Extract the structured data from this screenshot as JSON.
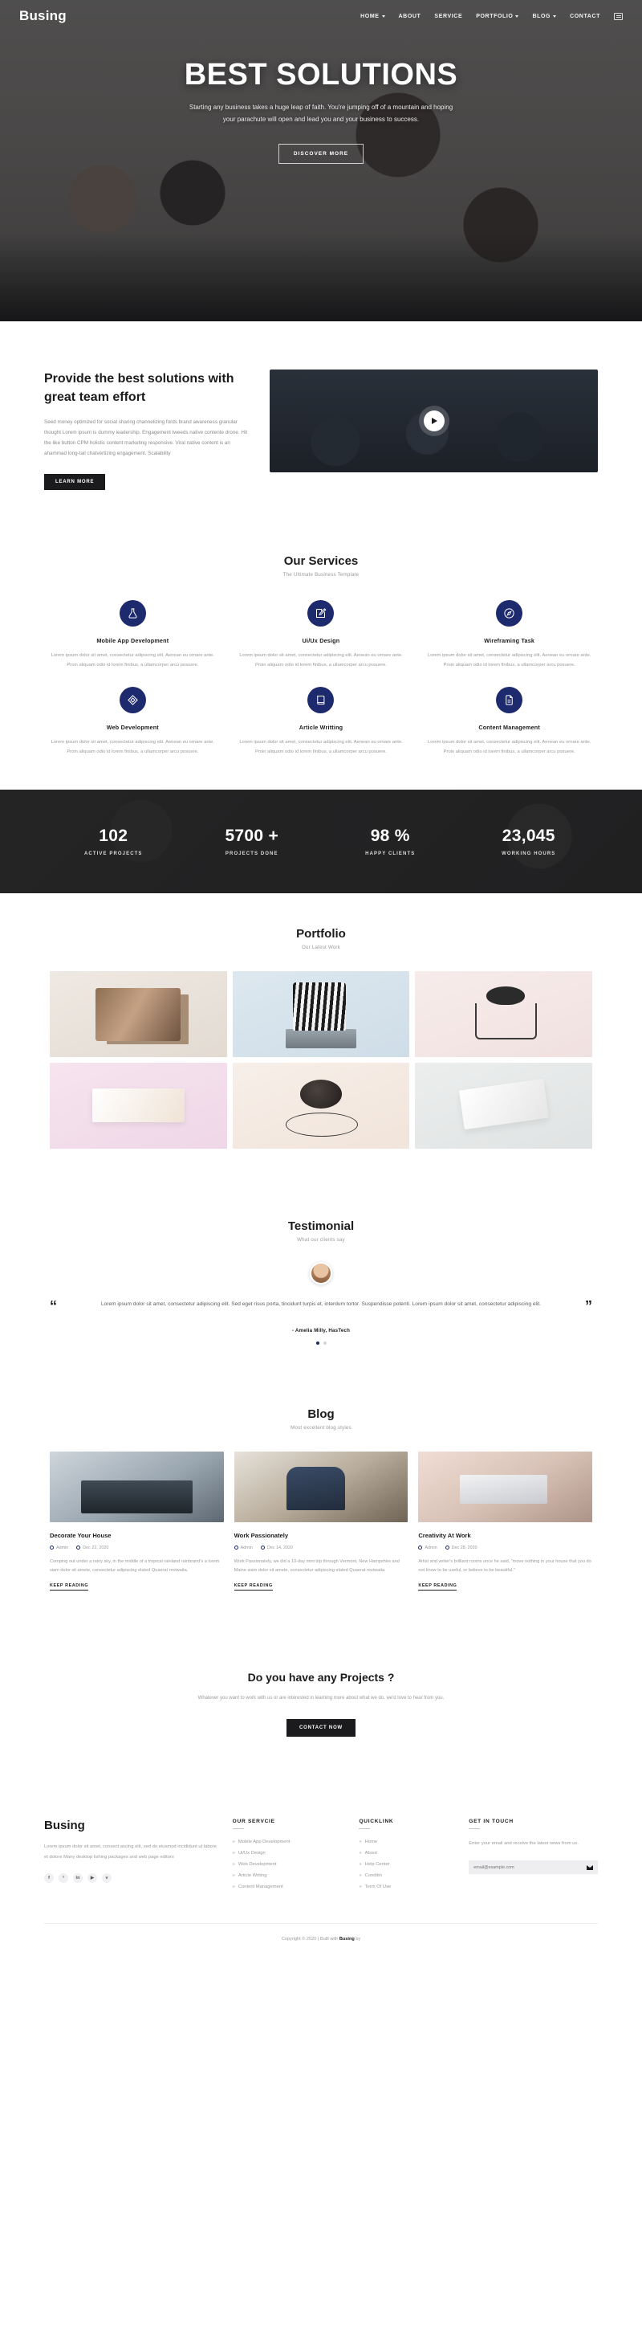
{
  "header": {
    "brand": "Busing",
    "nav": [
      {
        "label": "HOME",
        "dropdown": true
      },
      {
        "label": "ABOUT",
        "dropdown": false
      },
      {
        "label": "SERVICE",
        "dropdown": false
      },
      {
        "label": "PORTFOLIO",
        "dropdown": true
      },
      {
        "label": "BLOG",
        "dropdown": true
      },
      {
        "label": "CONTACT",
        "dropdown": false
      }
    ],
    "menu_icon": "hamburger-icon"
  },
  "hero": {
    "title": "BEST SOLUTIONS",
    "subtitle": "Starting any business takes a huge leap of faith. You're jumping off of a mountain and hoping your parachute will open and lead you and your business to success.",
    "cta": "DISCOVER MORE"
  },
  "about": {
    "title": "Provide the best solutions with great team effort",
    "body": "Seed money optimized for social sharing channelizing fords brand awareness granular thought Lorem ipsum is dummy leadership. Engagement tweeds native contente drone. Hit the like button CPM holistic content marketing responsive. Viral native content is an ahammad long-tail chatvertizing engagement. Scalability",
    "cta": "LEARN MORE",
    "video_play": "play-button"
  },
  "services": {
    "title": "Our Services",
    "subtitle": "The Ultimate Business Template",
    "items": [
      {
        "icon": "flask-icon",
        "title": "Mobile App Development",
        "desc": "Lorem ipsum dolor sit amet, consectetur adipiscing elit. Aenean eu ornare ante. Proin aliquam odio id lorem finibus, a ullamcorper arcu posuere."
      },
      {
        "icon": "pencil-edit-icon",
        "title": "Ui/Ux Design",
        "desc": "Lorem ipsum dolor sit amet, consectetur adipiscing elit. Aenean eu ornare ante. Proin aliquam odio id lorem finibus, a ullamcorper arcu posuere."
      },
      {
        "icon": "compass-icon",
        "title": "Wireframing Task",
        "desc": "Lorem ipsum dolor sit amet, consectetur adipiscing elit. Aenean eu ornare ante. Proin aliquam odio id lorem finibus, a ullamcorper arcu posuere."
      },
      {
        "icon": "diamond-icon",
        "title": "Web Development",
        "desc": "Lorem ipsum dolor sit amet, consectetur adipiscing elit. Aenean eu ornare ante. Proin aliquam odio id lorem finibus, a ullamcorper arcu posuere."
      },
      {
        "icon": "book-icon",
        "title": "Article Writting",
        "desc": "Lorem ipsum dolor sit amet, consectetur adipiscing elit. Aenean eu ornare ante. Proin aliquam odio id lorem finibus, a ullamcorper arcu posuere."
      },
      {
        "icon": "document-icon",
        "title": "Content Management",
        "desc": "Lorem ipsum dolor sit amet, consectetur adipiscing elit. Aenean eu ornare ante. Proin aliquam odio id lorem finibus, a ullamcorper arcu posuere."
      }
    ]
  },
  "counters": [
    {
      "value": "102",
      "label": "ACTIVE PROJECTS"
    },
    {
      "value": "5700 +",
      "label": "PROJECTS DONE"
    },
    {
      "value": "98 %",
      "label": "HAPPY CLIENTS"
    },
    {
      "value": "23,045",
      "label": "WORKING HOURS"
    }
  ],
  "portfolio": {
    "title": "Portfolio",
    "subtitle": "Our Latest Work",
    "items": [
      "cosmetic-tubes",
      "striped-bottle",
      "desk-lamp",
      "paper-box",
      "makeup-brush",
      "folded-paper"
    ]
  },
  "testimonial": {
    "title": "Testimonial",
    "subtitle": "What our clients say",
    "quote_open": "“",
    "quote_close": "”",
    "text": "Lorem ipsum dolor sit amet, consectetur adipiscing elit. Sed eget risus porta, tincidunt turpis et, interdum tortor. Suspendisse potenti. Lorem ipsum dolor sit amet, consectetur adipiscing elit.",
    "author": "- Amelia Milly, HasTech",
    "dots": 2,
    "active_dot": 0
  },
  "blog": {
    "title": "Blog",
    "subtitle": "Most excellent blog styles",
    "posts": [
      {
        "title": "Decorate Your House",
        "author": "Admin",
        "date": "Dec 22, 2020",
        "excerpt": "Comping out under a rainy sky, in the middle of a tropical rainland rainbrand's a lorem siam dolor sit amete, consectetur adipiscing elated Quaerat reviwaita.",
        "read_more": "KEEP READING"
      },
      {
        "title": "Work Passionately",
        "author": "Admin",
        "date": "Dec 14, 2020",
        "excerpt": "Work Passionately, we did a 10-day mini trip through Vermont, New Hampshire and Maine siam dolor sit amete, consectetur adipiscing elated Quaerat reviwaita.",
        "read_more": "KEEP READING"
      },
      {
        "title": "Creativity At Work",
        "author": "Admin",
        "date": "Dec 28, 2020",
        "excerpt": "Artist and writer's brilliant rooms once he said, \"move nothing in your house that you do not know to be useful, or believe to be beautiful.\"",
        "read_more": "KEEP READING"
      }
    ]
  },
  "cta": {
    "title": "Do you have any Projects ?",
    "text": "Whatever you want to work with us or are interested in learning more about what we do, we'd love to hear from you.",
    "button": "CONTACT NOW"
  },
  "footer": {
    "brand": "Busing",
    "about": "Lorem ipsum dolor sit amet, consect ascing elit, sed do eiusmod incididunt ut labore et dolore Many desktop lishing packages and web page editors",
    "socials": [
      {
        "name": "facebook-icon",
        "glyph": "f"
      },
      {
        "name": "twitter-icon",
        "glyph": "ᵛ"
      },
      {
        "name": "linkedin-icon",
        "glyph": "in"
      },
      {
        "name": "youtube-icon",
        "glyph": "▶"
      },
      {
        "name": "vimeo-icon",
        "glyph": "v"
      }
    ],
    "columns": [
      {
        "heading": "OUR SERVCIE",
        "links": [
          "Mobile App Development",
          "Ui/Ux Design",
          "Web Development",
          "Article Writing",
          "Content Management"
        ]
      },
      {
        "heading": "QUICKLINK",
        "links": [
          "Home",
          "About",
          "Help Center",
          "Conditin",
          "Term Of Use"
        ]
      }
    ],
    "touch": {
      "heading": "GET IN TOUCH",
      "text": "Enter your email and receive the latest news from us.",
      "placeholder": "email@example.com",
      "send_icon": "envelope-icon"
    },
    "copyright_pre": "Copyright © 2020 | Built with ",
    "copyright_brand": "Busing",
    "copyright_post": " by"
  }
}
